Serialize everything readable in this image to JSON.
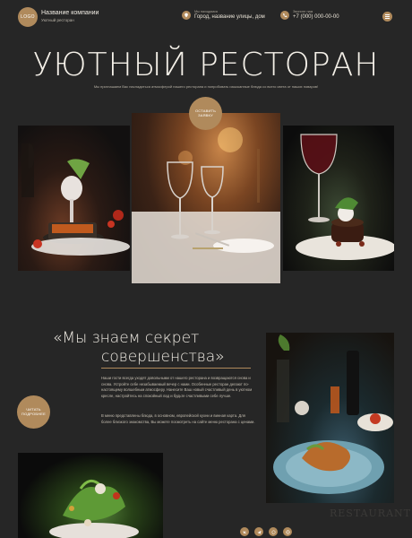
{
  "header": {
    "logo_text": "LOGO",
    "company_name": "Название компании",
    "company_sub": "Уютный ресторан",
    "address_label": "Мы находимся",
    "address_value": "Город, название улицы, дом",
    "phone_label": "Звоните нам",
    "phone_value": "+7 (000) 000-00-00"
  },
  "hero": {
    "title": "УЮТНЫЙ РЕСТОРАН",
    "subtitle": "Мы приглашаем Вас насладиться атмосферой нашего ресторана и попробовать изысканные блюда со всего света от наших поваров!",
    "order_button": "ОСТАВИТЬ ЗАЯВКУ"
  },
  "about": {
    "quote_line1": "«Мы знаем секрет",
    "quote_line2": "совершенства»",
    "read_button": "ЧИТАТЬ ПОДРОБНЕЕ",
    "paragraph1": "Наши гости всегда уходят довольными от нашего ресторана и возвращаются снова и снова. Устройте себе незабываемый вечер с нами. Особенные ресторан делают по-настоящему волшебным атмосферу. Нанесите Ваш новый счастливый день в уютном кресле, настройтесь на спокойный лад и будьте счастливыми себе лучше.",
    "paragraph2": "В меню представлены блюда, в основном, европейской кухни и винная карта. Для более близкого знакомства, Вы можете посмотреть на сайте меню ресторана с ценами.",
    "watermark": "RESTAURANT"
  },
  "socials": [
    "vk-icon",
    "telegram-icon",
    "whatsapp-icon",
    "instagram-icon"
  ],
  "colors": {
    "accent": "#b08a5c",
    "background": "#262626"
  }
}
